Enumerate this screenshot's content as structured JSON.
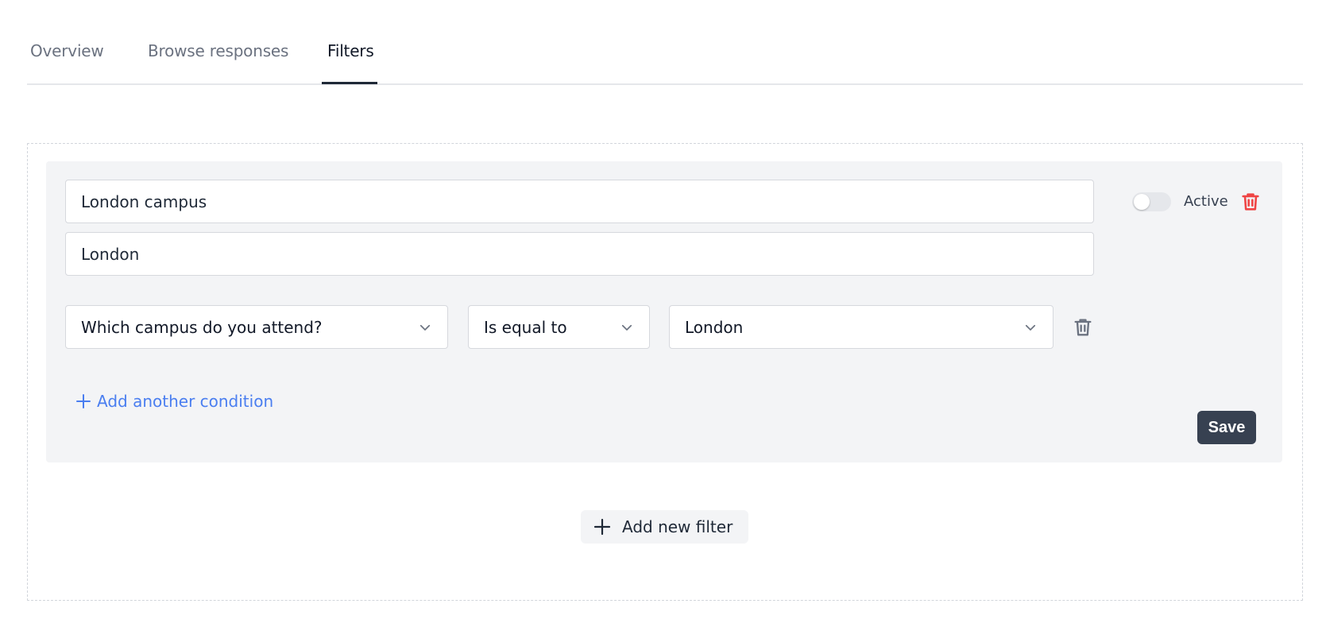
{
  "tabs": [
    {
      "label": "Overview",
      "active": false
    },
    {
      "label": "Browse responses",
      "active": false
    },
    {
      "label": "Filters",
      "active": true
    }
  ],
  "filter": {
    "name_value": "London campus",
    "description_value": "London",
    "active_label": "Active",
    "active": false,
    "condition": {
      "question": "Which campus do you attend?",
      "operator": "Is equal to",
      "value": "London"
    },
    "add_condition_label": "Add another condition",
    "save_label": "Save"
  },
  "add_filter_label": "Add new filter",
  "colors": {
    "accent_link": "#4a7ef0",
    "delete_red": "#ef4444",
    "save_bg": "#374151",
    "card_bg": "#f3f4f6"
  },
  "icons": {
    "delete_filter": "trash-icon",
    "delete_condition": "trash-icon",
    "dropdown": "chevron-down-icon",
    "add": "plus-icon"
  }
}
